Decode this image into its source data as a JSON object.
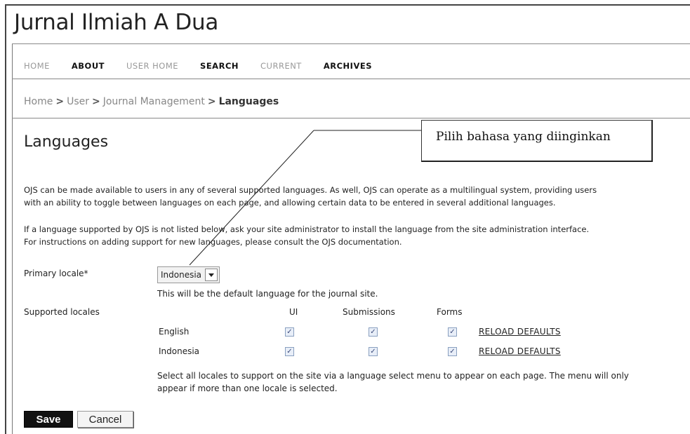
{
  "site": {
    "title": "Jurnal Ilmiah A Dua"
  },
  "nav": [
    {
      "label": "HOME"
    },
    {
      "label": "ABOUT"
    },
    {
      "label": "USER HOME"
    },
    {
      "label": "SEARCH"
    },
    {
      "label": "CURRENT"
    },
    {
      "label": "ARCHIVES"
    }
  ],
  "breadcrumb": {
    "items": [
      "Home",
      "User",
      "Journal Management",
      "Languages"
    ],
    "separator": ">"
  },
  "page": {
    "title": "Languages"
  },
  "callout": {
    "text": "Pilih bahasa yang diinginkan"
  },
  "intro": {
    "p1_line1": "OJS can be made available to users in any of several supported languages. As well, OJS can operate as a multilingual system, providing users",
    "p1_line2": "with an ability to toggle between languages on each page, and allowing certain data to be entered in several additional languages.",
    "p2_line1": "If a language supported by OJS is not listed below, ask your site administrator to install the language from the site administration interface.",
    "p2_line2": "For instructions on adding support for new languages, please consult the OJS documentation."
  },
  "form": {
    "primary_locale_label": "Primary locale*",
    "primary_locale_value": "Indonesia",
    "primary_locale_note": "This will be the default language for the journal site.",
    "supported_locales_label": "Supported locales",
    "columns": [
      "UI",
      "Submissions",
      "Forms"
    ],
    "locales": [
      {
        "name": "English",
        "ui": true,
        "submissions": true,
        "forms": true,
        "reload": "RELOAD DEFAULTS"
      },
      {
        "name": "Indonesia",
        "ui": true,
        "submissions": true,
        "forms": true,
        "reload": "RELOAD DEFAULTS"
      }
    ],
    "locales_note_line1": "Select all locales to support on the site via a language select menu to appear on each page. The menu will only",
    "locales_note_line2": "appear if more than one locale is selected.",
    "save_label": "Save",
    "cancel_label": "Cancel"
  },
  "check_glyph": "✓"
}
